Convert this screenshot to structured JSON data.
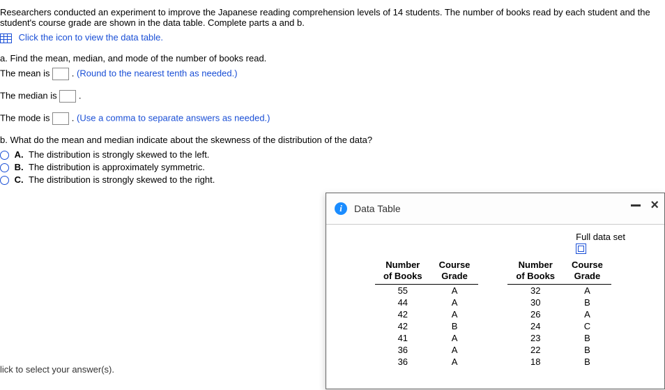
{
  "intro": "Researchers conducted an experiment to improve the Japanese reading comprehension levels of 14 students. The number of books read by each student and the student's course grade are shown in the data table. Complete parts a and b.",
  "click_link": "Click the icon to view the data table.",
  "part_a": {
    "prompt": "a. Find the mean, median, and mode of the number of books read.",
    "mean_pre": "The mean is ",
    "mean_post": ". ",
    "mean_hint": "(Round to the nearest tenth as needed.)",
    "median_pre": "The median is ",
    "median_post": ".",
    "mode_pre": "The mode is ",
    "mode_post": ". ",
    "mode_hint": "(Use a comma to separate answers as needed.)"
  },
  "part_b": {
    "prompt": "b. What do the mean and median indicate about the skewness of the distribution of the data?",
    "options": [
      {
        "letter": "A.",
        "text": "The distribution is strongly skewed to the left."
      },
      {
        "letter": "B.",
        "text": "The distribution is approximately symmetric."
      },
      {
        "letter": "C.",
        "text": "The distribution is strongly skewed to the right."
      }
    ]
  },
  "footer": "lick to select your answer(s).",
  "popup": {
    "title": "Data Table",
    "full_label": "Full data set",
    "headers": {
      "col1": "Number of Books",
      "col2": "Course Grade",
      "col3": "Number of Books",
      "col4": "Course Grade"
    },
    "rows": [
      {
        "n1": "55",
        "g1": "A",
        "n2": "32",
        "g2": "A"
      },
      {
        "n1": "44",
        "g1": "A",
        "n2": "30",
        "g2": "B"
      },
      {
        "n1": "42",
        "g1": "A",
        "n2": "26",
        "g2": "A"
      },
      {
        "n1": "42",
        "g1": "B",
        "n2": "24",
        "g2": "C"
      },
      {
        "n1": "41",
        "g1": "A",
        "n2": "23",
        "g2": "B"
      },
      {
        "n1": "36",
        "g1": "A",
        "n2": "22",
        "g2": "B"
      },
      {
        "n1": "36",
        "g1": "A",
        "n2": "18",
        "g2": "B"
      }
    ]
  },
  "chart_data": {
    "type": "table",
    "title": "Number of Books vs Course Grade (14 students)",
    "columns": [
      "Number of Books",
      "Course Grade"
    ],
    "rows": [
      [
        55,
        "A"
      ],
      [
        44,
        "A"
      ],
      [
        42,
        "A"
      ],
      [
        42,
        "B"
      ],
      [
        41,
        "A"
      ],
      [
        36,
        "A"
      ],
      [
        36,
        "A"
      ],
      [
        32,
        "A"
      ],
      [
        30,
        "B"
      ],
      [
        26,
        "A"
      ],
      [
        24,
        "C"
      ],
      [
        23,
        "B"
      ],
      [
        22,
        "B"
      ],
      [
        18,
        "B"
      ]
    ]
  }
}
